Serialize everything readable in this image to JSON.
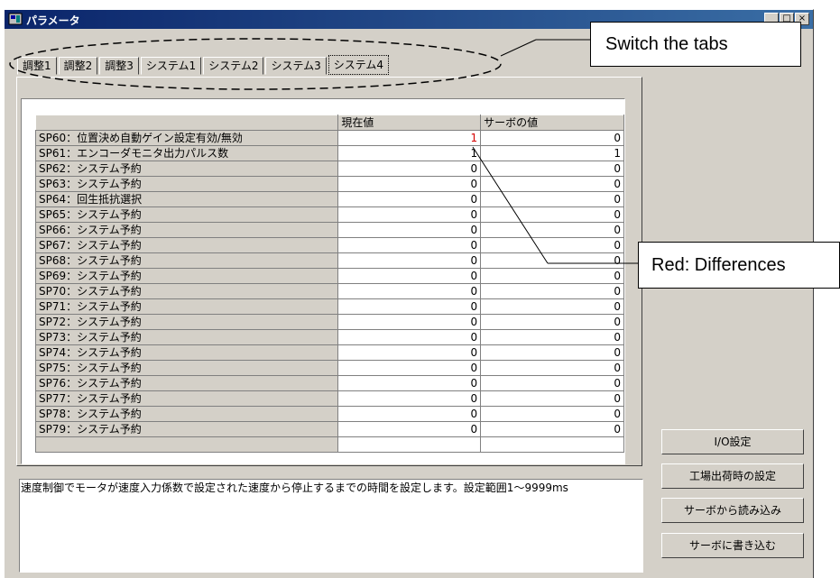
{
  "window": {
    "title": "パラメータ"
  },
  "tabs": [
    "調整1",
    "調整2",
    "調整3",
    "システム1",
    "システム2",
    "システム3",
    "システム4"
  ],
  "active_tab": "システム4",
  "grid": {
    "headers": [
      "",
      "現在値",
      "サーボの値"
    ],
    "rows": [
      {
        "name": "SP60：位置決め自動ゲイン設定有効/無効",
        "current": "1",
        "servo": "0",
        "diff": true
      },
      {
        "name": "SP61：エンコーダモニタ出力パルス数",
        "current": "1",
        "servo": "1"
      },
      {
        "name": "SP62：システム予約",
        "current": "0",
        "servo": "0"
      },
      {
        "name": "SP63：システム予約",
        "current": "0",
        "servo": "0"
      },
      {
        "name": "SP64：回生抵抗選択",
        "current": "0",
        "servo": "0"
      },
      {
        "name": "SP65：システム予約",
        "current": "0",
        "servo": "0"
      },
      {
        "name": "SP66：システム予約",
        "current": "0",
        "servo": "0"
      },
      {
        "name": "SP67：システム予約",
        "current": "0",
        "servo": "0"
      },
      {
        "name": "SP68：システム予約",
        "current": "0",
        "servo": "0"
      },
      {
        "name": "SP69：システム予約",
        "current": "0",
        "servo": "0"
      },
      {
        "name": "SP70：システム予約",
        "current": "0",
        "servo": "0"
      },
      {
        "name": "SP71：システム予約",
        "current": "0",
        "servo": "0"
      },
      {
        "name": "SP72：システム予約",
        "current": "0",
        "servo": "0"
      },
      {
        "name": "SP73：システム予約",
        "current": "0",
        "servo": "0"
      },
      {
        "name": "SP74：システム予約",
        "current": "0",
        "servo": "0"
      },
      {
        "name": "SP75：システム予約",
        "current": "0",
        "servo": "0"
      },
      {
        "name": "SP76：システム予約",
        "current": "0",
        "servo": "0"
      },
      {
        "name": "SP77：システム予約",
        "current": "0",
        "servo": "0"
      },
      {
        "name": "SP78：システム予約",
        "current": "0",
        "servo": "0"
      },
      {
        "name": "SP79：システム予約",
        "current": "0",
        "servo": "0"
      }
    ]
  },
  "description": "速度制御でモータが速度入力係数で設定された速度から停止するまでの時間を設定します。設定範囲1～9999ms",
  "buttons": {
    "io": "I/O設定",
    "factory": "工場出荷時の設定",
    "read": "サーボから読み込み",
    "write": "サーボに書き込む"
  },
  "callouts": {
    "tabs": "Switch the tabs",
    "diff": "Red: Differences"
  },
  "colors": {
    "diff": "#d40000",
    "titlebar": "#0a246a"
  }
}
